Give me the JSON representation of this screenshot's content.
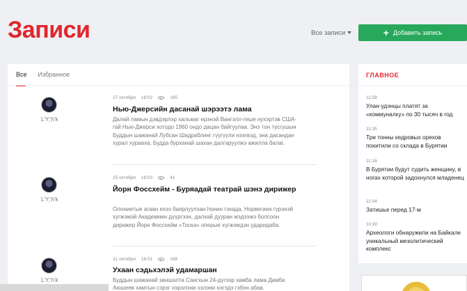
{
  "header": {
    "title": "Записи",
    "filter_label": "Все записи",
    "add_button_label": "Добавить запись"
  },
  "tabs": [
    {
      "label": "Все",
      "active": true
    },
    {
      "label": "Избранное",
      "active": false
    }
  ],
  "posts": [
    {
      "author": "L'Y;'h'k",
      "date": "27 октября",
      "time": "18:02",
      "views": "165",
      "title": "Нью-Джерсийн дасанай шэрээтэ лама",
      "text": "Далай ламын дэвдэрлэр хальмаг ерэнэй Вангэлл-геше нухэртэв США-гай Нью-Джерси хотодо 1960 ондо дацан байгуулаа. Энэ тон тусгушын Буддын шажанай Лубсан Шидраблинг гүүгүүли нээгвэд, эна дасандан хурал хурааха; Будда бурханай шахан далгаруулжэ ажилла балаі."
    },
    {
      "author": "L'Y;'h'k",
      "date": "25 октября",
      "time": "18:03",
      "views": "41",
      "title": "Йорн Фоссхейм - Буряадай театрай шэнэ дирижер",
      "text": "Олониитые агаан ехээ баярлуулхан hонин гэхада, Норвегиин гүрэнэй хугжэмэй Академиин дүүргээн, далхай дууран мэдээжэ болсоон дирижер Йорн Фоссхейм «Тоска» оперые хүгжэмдэн ударидаба."
    },
    {
      "author": "L'Y;'h'k",
      "date": "21 октября",
      "time": "18:01",
      "views": "168",
      "title": "Ухаан сэдьхэлэй удамаршан",
      "text": "Буддын шажанай заншалта Сангхын 24-дүгээр хамба лама Дамба Аюшеев хамтын сэрэг нэрэлэни хэлэни нэгэдэ гэбэн абаа."
    }
  ],
  "sidebar": {
    "title": "ГЛАВНОЕ",
    "news": [
      {
        "time": "11:58",
        "title": "Улан-удэнцы платят за «коммуналку» по 30 тысяч в год"
      },
      {
        "time": "11:35",
        "title": "Три тонны кедровых орехов похитили со склада в Бурятии"
      },
      {
        "time": "11:16",
        "title": "В Бурятии будут судить женщину, в ногах которой задохнулся младенец"
      },
      {
        "time": "11:04",
        "title": "Затишье перед 17-м"
      },
      {
        "time": "10:30",
        "title": "Археологи обнаружили на Байкале уникальный мезолитический комплекс"
      }
    ]
  },
  "colors": {
    "accent": "#e0262e",
    "button": "#27a85a",
    "background": "#eef0f3"
  }
}
